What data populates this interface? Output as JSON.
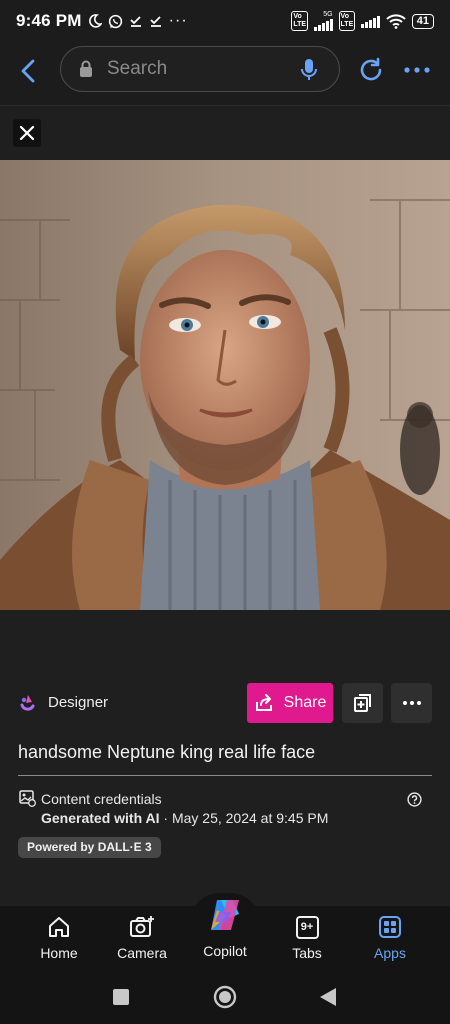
{
  "status_bar": {
    "time": "9:46 PM",
    "icons": [
      "moon-icon",
      "whatsapp-icon",
      "download-done-icon",
      "download-done-icon",
      "more-dots-icon"
    ],
    "network_label": "5G",
    "battery": "41"
  },
  "browser": {
    "search_placeholder": "Search",
    "search_value": ""
  },
  "image": {
    "description_icon": "portrait-photo"
  },
  "designer": {
    "app_name": "Designer",
    "share_label": "Share"
  },
  "prompt": "handsome Neptune king real life face",
  "credentials": {
    "title": "Content credentials",
    "generated_bold": "Generated with AI",
    "generated_rest": " · May 25, 2024 at 9:45 PM",
    "badge": "Powered by DALL·E 3"
  },
  "bottom_nav": {
    "items": [
      {
        "label": "Home",
        "icon": "home-icon"
      },
      {
        "label": "Camera",
        "icon": "camera-icon"
      },
      {
        "label": "Copilot",
        "icon": "copilot-icon"
      },
      {
        "label": "Tabs",
        "icon": "tabs-icon",
        "count": "9+"
      },
      {
        "label": "Apps",
        "icon": "apps-icon"
      }
    ],
    "active": "Apps"
  },
  "colors": {
    "accent_blue": "#68a3f4",
    "share_pink": "#e0198f",
    "background": "#1f1f1f"
  }
}
